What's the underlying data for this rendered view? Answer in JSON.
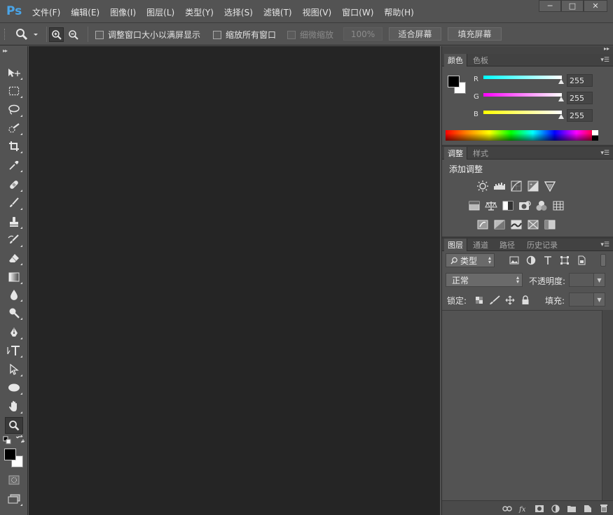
{
  "app": {
    "logo": "Ps",
    "menu": [
      "文件(F)",
      "编辑(E)",
      "图像(I)",
      "图层(L)",
      "类型(Y)",
      "选择(S)",
      "滤镜(T)",
      "视图(V)",
      "窗口(W)",
      "帮助(H)"
    ],
    "window_buttons": {
      "minimize": "─",
      "restore": "□",
      "close": "✕"
    }
  },
  "options": {
    "resize_windows_label": "调整窗口大小以满屏显示",
    "zoom_all_label": "缩放所有窗口",
    "scrubby_zoom_label": "细微缩放",
    "zoom_percent": "100%",
    "fit_screen_label": "适合屏幕",
    "fill_screen_label": "填充屏幕"
  },
  "toolbar": {
    "collapse": "▸▸",
    "tools": [
      "move",
      "marquee",
      "lasso",
      "quick-select",
      "crop",
      "eyedropper",
      "healing-brush",
      "brush",
      "clone-stamp",
      "history-brush",
      "eraser",
      "gradient",
      "blur",
      "dodge",
      "pen",
      "type",
      "path-select",
      "ellipse",
      "hand",
      "zoom"
    ],
    "selected_tool": "zoom",
    "foreground_color": "#000000",
    "background_color": "#ffffff"
  },
  "color_panel": {
    "tabs": [
      "颜色",
      "色板"
    ],
    "active_tab": 0,
    "channels": [
      {
        "label": "R",
        "value": "255",
        "gradient": "linear-gradient(to right, #00ffff, #ffffff)"
      },
      {
        "label": "G",
        "value": "255",
        "gradient": "linear-gradient(to right, #ff00ff, #ffffff)"
      },
      {
        "label": "B",
        "value": "255",
        "gradient": "linear-gradient(to right, #ffff00, #ffffff)"
      }
    ]
  },
  "adjust_panel": {
    "tabs": [
      "调整",
      "样式"
    ],
    "active_tab": 0,
    "title": "添加调整"
  },
  "layers_panel": {
    "tabs": [
      "图层",
      "通道",
      "路径",
      "历史记录"
    ],
    "active_tab": 0,
    "filter_label": "类型",
    "blend_mode": "正常",
    "opacity_label": "不透明度:",
    "lock_label": "锁定:",
    "fill_label": "填充:"
  },
  "colors": {
    "panel_bg": "#535353",
    "canvas_bg": "#252525",
    "logo_blue": "#4aa5e8"
  }
}
